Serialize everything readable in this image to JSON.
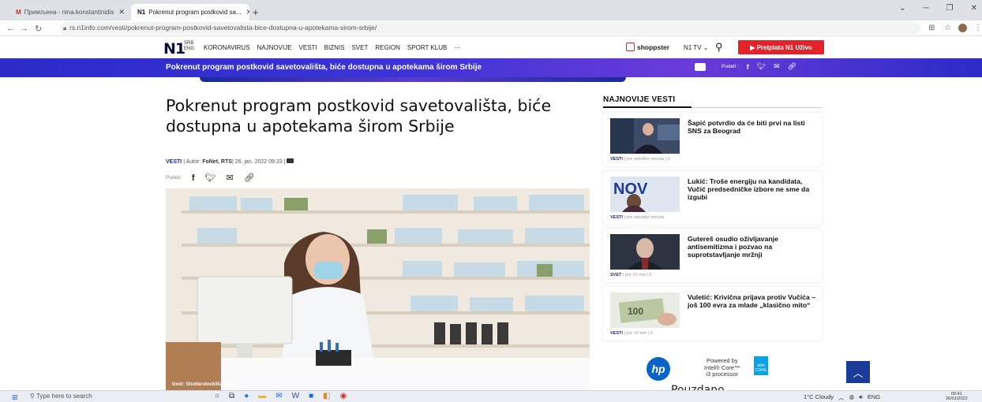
{
  "browser": {
    "tabs": [
      {
        "icon": "gmail-icon",
        "label": "Примљена - nina.konstantinidis"
      },
      {
        "icon": "n1-icon",
        "label": "Pokrenut program postkovid sa..."
      }
    ],
    "url": "rs.n1info.com/vesti/pokrenut-program-postkovid-savetovalista-bice-dostupna-u-apotekama-sirom-srbije/"
  },
  "header": {
    "logo": "N1",
    "lang_top": "SRB",
    "lang_bottom": "ENG",
    "nav": [
      "KORONAVIRUS",
      "NAJNOVIJE",
      "VESTI",
      "BIZNIS",
      "SVET",
      "REGION",
      "SPORT KLUB",
      "···"
    ],
    "shoppster": "shoppster",
    "n1tv": "N1 TV",
    "subscribe": "▶ Pretplata N1 Uživo"
  },
  "sticky": {
    "title": "Pokrenut program postkovid savetovališta, biće dostupna u apotekama širom Srbije",
    "share_label": "Podeli :"
  },
  "article": {
    "title": "Pokrenut program postkovid savetovališta, biće dostupna u apotekama širom Srbije",
    "category": "VESTI",
    "author_prefix": "| Autor:",
    "author": "FoNet, RTS",
    "date": "| 26. jan. 2022 09:33 |",
    "share_label": "Podeli:",
    "photo_caption": "Izvor: Shutterstock/ilustracija"
  },
  "sidebar": {
    "heading": "NAJNOVIJE VESTI",
    "items": [
      {
        "title": "Šapić potvrdio da će biti prvi na listi SNS za Beograd",
        "category": "VESTI",
        "meta": "| pre nekoliko minuta |  0"
      },
      {
        "title": "Lukić: Troše energiju na kandidata, Vučić predsedničke izbore ne sme da izgubi",
        "category": "VESTI",
        "meta": "| pre nekoliko minuta"
      },
      {
        "title": "Gutereš osudio oživljavanje antisemitizma i pozvao na suprotstavljanje mržnji",
        "category": "SVET",
        "meta": "| pre 10 min |  0"
      },
      {
        "title": "Vuletić: Krivična prijava protiv Vučića – još 100 evra za mlade „klasično mito“",
        "category": "VESTI",
        "meta": "| pre 19 min |  0"
      }
    ]
  },
  "ad": {
    "brand": "hp",
    "line1": "Powered by",
    "line2": "Intel® Core™",
    "line3": "i3 processor",
    "badge": "intel CORE",
    "partial_text": "Pouzdano"
  },
  "taskbar": {
    "search_placeholder": "Type here to search",
    "weather": "1°C  Cloudy",
    "lang": "ENG",
    "time": "09:41",
    "date": "26/01/2022"
  }
}
